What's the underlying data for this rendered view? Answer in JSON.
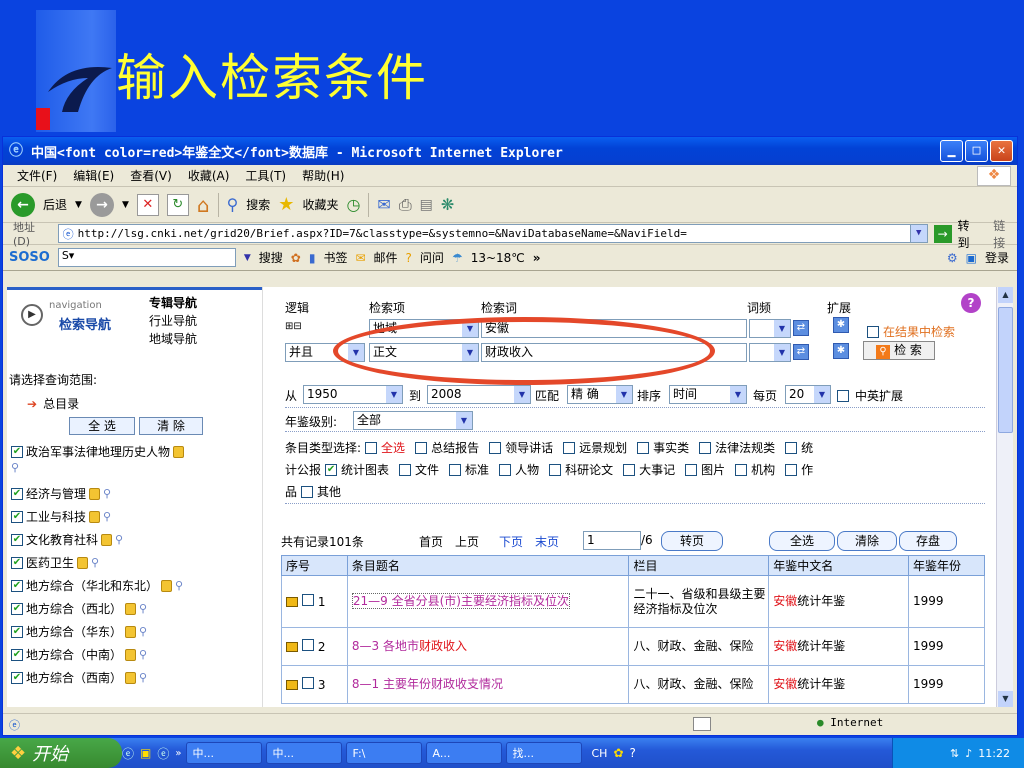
{
  "slide": {
    "title": "输入检索条件"
  },
  "window": {
    "title": "中国<font color=red>年鉴全文</font>数据库 - Microsoft Internet Explorer",
    "menu": [
      "文件(F)",
      "编辑(E)",
      "查看(V)",
      "收藏(A)",
      "工具(T)",
      "帮助(H)"
    ],
    "toolbar": {
      "back": "后退",
      "search": "搜索",
      "favorites": "收藏夹"
    },
    "address": {
      "label": "地址(D)",
      "url": "http://lsg.cnki.net/grid20/Brief.aspx?ID=7&classtype=&systemno=&NaviDatabaseName=&NaviField=",
      "go": "转到",
      "links": "链接"
    },
    "sosobar": {
      "logo": "SOSO",
      "search": "搜搜",
      "bookmarks": "书签",
      "mail": "邮件",
      "ask": "问问",
      "weather": "13~18℃",
      "login": "登录"
    },
    "status": {
      "zone": "Internet"
    }
  },
  "nav": {
    "badge_en": "navigation",
    "badge_cn": "检索导航",
    "links": [
      "专辑导航",
      "行业导航",
      "地域导航"
    ],
    "range_label": "请选择查询范围:",
    "total": "总目录",
    "select_all": "全 选",
    "clear": "清 除",
    "categories": [
      "政治军事法律地理历史人物",
      "经济与管理",
      "工业与科技",
      "文化教育社科",
      "医药卫生",
      "地方综合（华北和东北）",
      "地方综合（西北）",
      "地方综合（华东）",
      "地方综合（中南）",
      "地方综合（西南）"
    ]
  },
  "search": {
    "headers": {
      "logic": "逻辑",
      "field": "检索项",
      "term": "检索词",
      "freq": "词频",
      "expand": "扩展"
    },
    "row1": {
      "field": "地域",
      "term": "安徽"
    },
    "row2": {
      "logic": "并且",
      "field": "正文",
      "term": "财政收入"
    },
    "in_results": "在结果中检索",
    "search_btn": "检 索",
    "from_label": "从",
    "from_year": "1950",
    "to_label": "到",
    "to_year": "2008",
    "match_label": "匹配",
    "match_value": "精 确",
    "sort_label": "排序",
    "sort_value": "时间",
    "per_page_label": "每页",
    "per_page_value": "20",
    "cn_en": "中英扩展",
    "level_label": "年鉴级别:",
    "level_value": "全部",
    "type_label": "条目类型选择:",
    "types": [
      "全选",
      "总结报告",
      "领导讲话",
      "远景规划",
      "事实类",
      "法律法规类",
      "统计公报",
      "统计图表",
      "文件",
      "标准",
      "人物",
      "科研论文",
      "大事记",
      "图片",
      "机构",
      "作品",
      "其他"
    ]
  },
  "pager": {
    "total": "共有记录101条",
    "first": "首页",
    "prev": "上页",
    "next": "下页",
    "last": "末页",
    "page": "1",
    "pages": "/6",
    "go": "转页",
    "select_all": "全选",
    "clear": "清除",
    "save": "存盘"
  },
  "results": {
    "columns": [
      "序号",
      "条目题名",
      "栏目",
      "年鉴中文名",
      "年鉴年份"
    ],
    "rows": [
      {
        "no": "1",
        "title": "21—9 全省分县(市)主要经济指标及位次",
        "column": "二十一、省级和县级主要经济指标及位次",
        "name_hl": "安徽",
        "name_rest": "统计年鉴",
        "year": "1999"
      },
      {
        "no": "2",
        "title_pre": "8—3 各地市",
        "title_hl": "财政收入",
        "column": "八、财政、金融、保险",
        "name_hl": "安徽",
        "name_rest": "统计年鉴",
        "year": "1999"
      },
      {
        "no": "3",
        "title": "8—1 主要年份财政收支情况",
        "column": "八、财政、金融、保险",
        "name_hl": "安徽",
        "name_rest": "统计年鉴",
        "year": "1999"
      }
    ]
  },
  "taskbar": {
    "start": "开始",
    "tasks": [
      "中...",
      "中...",
      "F:\\",
      "A...",
      "找..."
    ],
    "lang": "CH",
    "clock": "11:22"
  }
}
